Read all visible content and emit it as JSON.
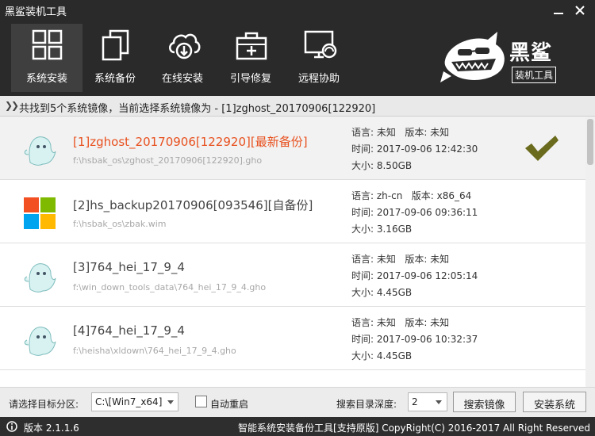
{
  "app": {
    "title": "黑鲨装机工具"
  },
  "toolbar": [
    {
      "label": "系统安装",
      "icon": "windows-tiles-icon",
      "active": true
    },
    {
      "label": "系统备份",
      "icon": "copy-icon",
      "active": false
    },
    {
      "label": "在线安装",
      "icon": "cloud-download-icon",
      "active": false
    },
    {
      "label": "引导修复",
      "icon": "toolbox-icon",
      "active": false
    },
    {
      "label": "远程协助",
      "icon": "monitor-headset-icon",
      "active": false
    }
  ],
  "logo": {
    "big": "黑鲨",
    "small": "装机工具"
  },
  "info": {
    "text": "共找到5个系统镜像，当前选择系统镜像为 - [1]zghost_20170906[122920]"
  },
  "images": [
    {
      "name": "[1]zghost_20170906[122920][最新备份]",
      "path": "f:\\hsbak_os\\zghost_20170906[122920].gho",
      "lang": "语言: 未知",
      "ver": "版本: 未知",
      "time": "时间: 2017-09-06 12:42:30",
      "size": "大小: 8.50GB",
      "icon": "ghost-icon",
      "selected": true
    },
    {
      "name": "[2]hs_backup20170906[093546][自备份]",
      "path": "f:\\hsbak_os\\zbak.wim",
      "lang": "语言: zh-cn",
      "ver": "版本: x86_64",
      "time": "时间: 2017-09-06 09:36:11",
      "size": "大小: 3.16GB",
      "icon": "windows-logo-icon",
      "selected": false
    },
    {
      "name": "[3]764_hei_17_9_4",
      "path": "f:\\win_down_tools_data\\764_hei_17_9_4.gho",
      "lang": "语言: 未知",
      "ver": "版本: 未知",
      "time": "时间: 2017-09-06 12:05:14",
      "size": "大小: 4.45GB",
      "icon": "ghost-icon",
      "selected": false
    },
    {
      "name": "[4]764_hei_17_9_4",
      "path": "f:\\heisha\\xldown\\764_hei_17_9_4.gho",
      "lang": "语言: 未知",
      "ver": "版本: 未知",
      "time": "时间: 2017-09-06 10:32:37",
      "size": "大小: 4.45GB",
      "icon": "ghost-icon",
      "selected": false
    }
  ],
  "bottom": {
    "target_label": "请选择目标分区:",
    "target_value": "C:\\[Win7_x64]",
    "auto_restart": "自动重启",
    "depth_label": "搜索目录深度:",
    "depth_value": "2",
    "search_btn": "搜索镜像",
    "install_btn": "安装系统"
  },
  "status": {
    "version": "版本 2.1.1.6",
    "footer": "智能系统安装备份工具[支持原版]  CopyRight(C) 2016-2017 All Right Reserved"
  },
  "colors": {
    "accent": "#e8501e",
    "check": "#6b6b1e",
    "header": "#2a2a2a"
  }
}
